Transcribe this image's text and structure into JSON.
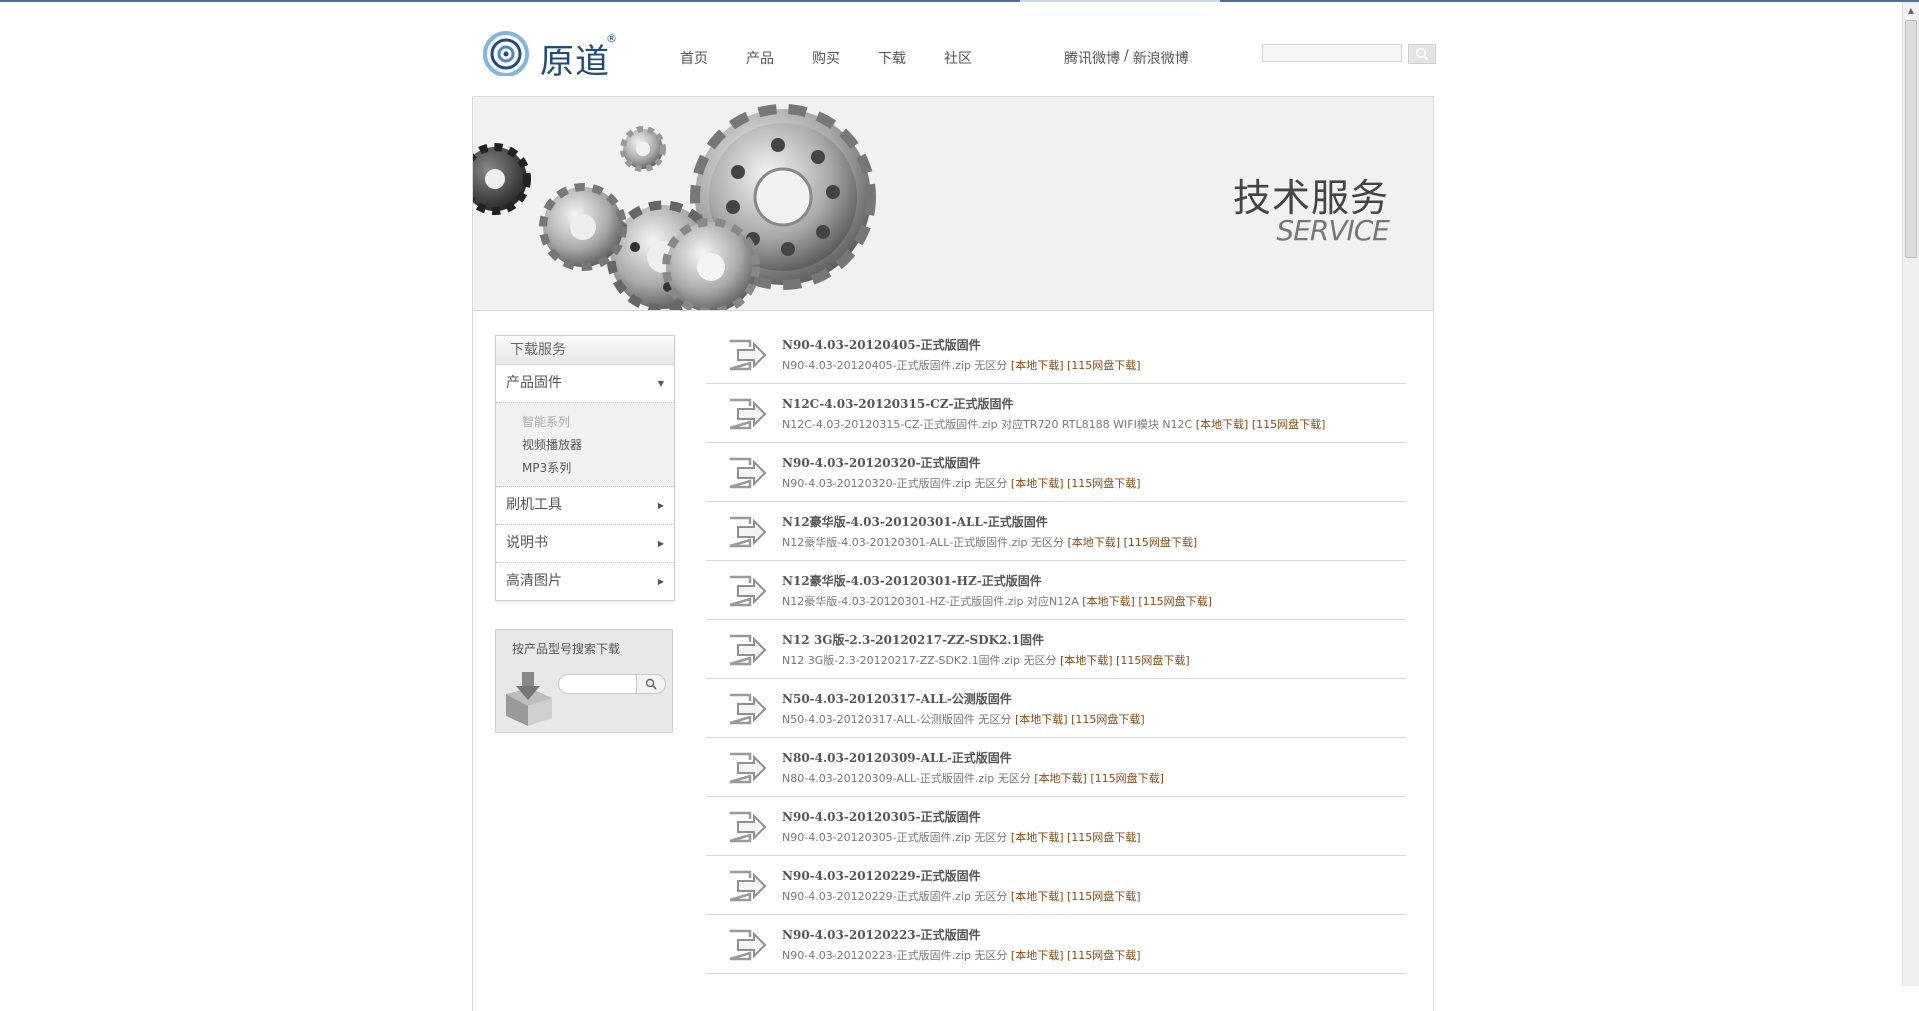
{
  "brand": {
    "logo_text": "原道",
    "logo_mark": "®"
  },
  "nav": [
    {
      "label": "首页"
    },
    {
      "label": "产品"
    },
    {
      "label": "购买"
    },
    {
      "label": "下载"
    },
    {
      "label": "社区"
    }
  ],
  "weibo": {
    "tencent": "腾讯微博",
    "separator": "/",
    "sina": "新浪微博"
  },
  "header_search": {
    "placeholder": ""
  },
  "banner": {
    "title_cn": "技术服务",
    "title_en": "SERVICE"
  },
  "sidebar": {
    "heading": "下载服务",
    "firmware": {
      "label": "产品固件",
      "arrow": "▼"
    },
    "firmware_sub": [
      "智能系列",
      "视频播放器",
      "MP3系列"
    ],
    "items": [
      {
        "label": "刷机工具",
        "arrow": "▶"
      },
      {
        "label": "说明书",
        "arrow": "▶"
      },
      {
        "label": "高清图片",
        "arrow": "▶"
      }
    ]
  },
  "model_search": {
    "title": "按产品型号搜索下载",
    "placeholder": ""
  },
  "downloads": [
    {
      "title": "N90-4.03-20120405-正式版固件",
      "desc": "N90-4.03-20120405-正式版固件.zip 无区分",
      "local": "[本地下载]",
      "cloud": "[115网盘下载]"
    },
    {
      "title": "N12C-4.03-20120315-CZ-正式版固件",
      "desc": "N12C-4.03-20120315-CZ-正式版固件.zip 对应TR720 RTL8188 WIFI模块 N12C",
      "local": "[本地下载]",
      "cloud": "[115网盘下载]"
    },
    {
      "title": "N90-4.03-20120320-正式版固件",
      "desc": "N90-4.03-20120320-正式版固件.zip 无区分",
      "local": "[本地下载]",
      "cloud": "[115网盘下载]"
    },
    {
      "title": "N12豪华版-4.03-20120301-ALL-正式版固件",
      "desc": "N12豪华版-4.03-20120301-ALL-正式版固件.zip 无区分",
      "local": "[本地下载]",
      "cloud": "[115网盘下载]"
    },
    {
      "title": "N12豪华版-4.03-20120301-HZ-正式版固件",
      "desc": "N12豪华版-4.03-20120301-HZ-正式版固件.zip 对应N12A",
      "local": "[本地下载]",
      "cloud": "[115网盘下载]"
    },
    {
      "title": "N12 3G版-2.3-20120217-ZZ-SDK2.1固件",
      "desc": "N12 3G版-2.3-20120217-ZZ-SDK2.1固件.zip 无区分",
      "local": "[本地下载]",
      "cloud": "[115网盘下载]"
    },
    {
      "title": "N50-4.03-20120317-ALL-公测版固件",
      "desc": "N50-4.03-20120317-ALL-公测版固件 无区分",
      "local": "[本地下载]",
      "cloud": "[115网盘下载]"
    },
    {
      "title": "N80-4.03-20120309-ALL-正式版固件",
      "desc": "N80-4.03-20120309-ALL-正式版固件.zip 无区分",
      "local": "[本地下载]",
      "cloud": "[115网盘下载]"
    },
    {
      "title": "N90-4.03-20120305-正式版固件",
      "desc": "N90-4.03-20120305-正式版固件.zip 无区分",
      "local": "[本地下载]",
      "cloud": "[115网盘下载]"
    },
    {
      "title": "N90-4.03-20120229-正式版固件",
      "desc": "N90-4.03-20120229-正式版固件.zip 无区分",
      "local": "[本地下载]",
      "cloud": "[115网盘下载]"
    },
    {
      "title": "N90-4.03-20120223-正式版固件",
      "desc": "N90-4.03-20120223-正式版固件.zip 无区分",
      "local": "[本地下载]",
      "cloud": "[115网盘下载]"
    }
  ],
  "colors": {
    "accent_link": "#8a4a12",
    "brand_blue": "#1f4c7e"
  }
}
